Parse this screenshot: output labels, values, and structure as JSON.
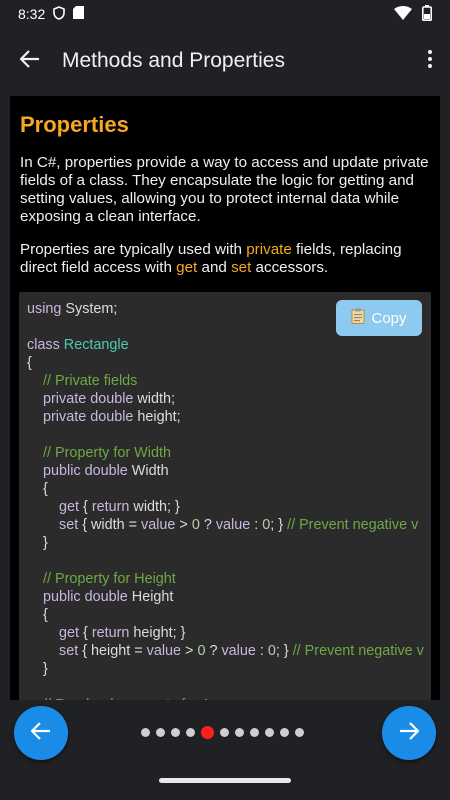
{
  "status_bar": {
    "time": "8:32",
    "icons": [
      "shield-icon",
      "sd-card-icon"
    ],
    "right_icons": [
      "wifi-icon",
      "battery-icon"
    ]
  },
  "app_bar": {
    "title": "Methods and Properties",
    "back_icon": "arrow-left-icon",
    "menu_icon": "more-vert-icon"
  },
  "section": {
    "title": "Properties",
    "paragraph1": "In C#, properties provide a way to access and update private fields of a class. They encapsulate the logic for getting and setting values, allowing you to protect internal data while exposing a clean interface.",
    "paragraph2": {
      "t1": "Properties are typically used with ",
      "k1": "private",
      "t2": " fields, replacing direct field access with ",
      "k2": "get",
      "t3": " and ",
      "k3": "set",
      "t4": " accessors."
    }
  },
  "code": {
    "copy_label": "Copy",
    "copy_icon": "clipboard-icon",
    "lines": [
      [
        [
          "kw",
          "using"
        ],
        [
          "id",
          " System;"
        ]
      ],
      [],
      [
        [
          "kw",
          "class"
        ],
        [
          "id",
          " "
        ],
        [
          "type",
          "Rectangle"
        ]
      ],
      [
        [
          "id",
          "{"
        ]
      ],
      [
        [
          "id",
          "    "
        ],
        [
          "cm",
          "// Private fields"
        ]
      ],
      [
        [
          "id",
          "    "
        ],
        [
          "kw",
          "private double"
        ],
        [
          "id",
          " width;"
        ]
      ],
      [
        [
          "id",
          "    "
        ],
        [
          "kw",
          "private double"
        ],
        [
          "id",
          " height;"
        ]
      ],
      [],
      [
        [
          "id",
          "    "
        ],
        [
          "cm",
          "// Property for Width"
        ]
      ],
      [
        [
          "id",
          "    "
        ],
        [
          "kw",
          "public double"
        ],
        [
          "id",
          " Width"
        ]
      ],
      [
        [
          "id",
          "    {"
        ]
      ],
      [
        [
          "id",
          "        "
        ],
        [
          "kw",
          "get"
        ],
        [
          "id",
          " { "
        ],
        [
          "kw",
          "return"
        ],
        [
          "id",
          " width; }"
        ]
      ],
      [
        [
          "id",
          "        "
        ],
        [
          "kw",
          "set"
        ],
        [
          "id",
          " { width = "
        ],
        [
          "kw",
          "value"
        ],
        [
          "id",
          " > "
        ],
        [
          "num",
          "0"
        ],
        [
          "id",
          " ? "
        ],
        [
          "kw",
          "value"
        ],
        [
          "id",
          " : "
        ],
        [
          "num",
          "0"
        ],
        [
          "id",
          "; } "
        ],
        [
          "cm",
          "// Prevent negative v"
        ]
      ],
      [
        [
          "id",
          "    }"
        ]
      ],
      [],
      [
        [
          "id",
          "    "
        ],
        [
          "cm",
          "// Property for Height"
        ]
      ],
      [
        [
          "id",
          "    "
        ],
        [
          "kw",
          "public double"
        ],
        [
          "id",
          " Height"
        ]
      ],
      [
        [
          "id",
          "    {"
        ]
      ],
      [
        [
          "id",
          "        "
        ],
        [
          "kw",
          "get"
        ],
        [
          "id",
          " { "
        ],
        [
          "kw",
          "return"
        ],
        [
          "id",
          " height; }"
        ]
      ],
      [
        [
          "id",
          "        "
        ],
        [
          "kw",
          "set"
        ],
        [
          "id",
          " { height = "
        ],
        [
          "kw",
          "value"
        ],
        [
          "id",
          " > "
        ],
        [
          "num",
          "0"
        ],
        [
          "id",
          " ? "
        ],
        [
          "kw",
          "value"
        ],
        [
          "id",
          " : "
        ],
        [
          "num",
          "0"
        ],
        [
          "id",
          "; } "
        ],
        [
          "cm",
          "// Prevent negative v"
        ]
      ],
      [
        [
          "id",
          "    }"
        ]
      ],
      [],
      [
        [
          "id",
          "    "
        ],
        [
          "cm",
          "// Read-only property for Area"
        ]
      ]
    ]
  },
  "pager": {
    "prev_icon": "arrow-left-icon",
    "next_icon": "arrow-right-icon",
    "total_pages": 11,
    "current_page": 5
  },
  "colors": {
    "accent_orange": "#f5a623",
    "fab_blue": "#1a8ce8",
    "active_dot": "#ff1e1e",
    "copy_button": "#8ec9f0"
  }
}
